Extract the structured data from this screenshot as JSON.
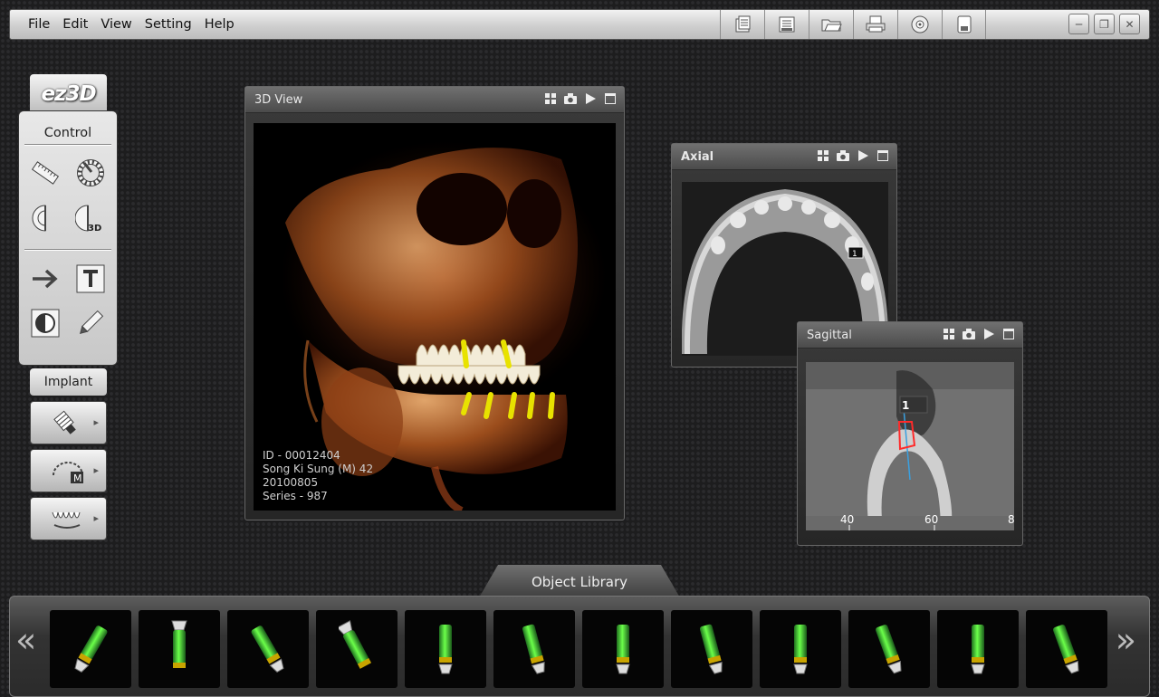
{
  "menu": {
    "items": [
      "File",
      "Edit",
      "View",
      "Setting",
      "Help"
    ]
  },
  "toolbar_icons": [
    "document-list-icon",
    "save-icon",
    "open-folder-icon",
    "print-icon",
    "disc-icon",
    "save-as-icon"
  ],
  "logo": {
    "text": "ez3D"
  },
  "control": {
    "title": "Control",
    "tools": [
      "ruler-icon",
      "angle-ring-icon",
      "half-circle-icon",
      "half-circle-3d-icon",
      "arrow-icon",
      "text-tool-icon",
      "contrast-icon",
      "pencil-icon"
    ]
  },
  "implant": {
    "label": "Implant",
    "buttons": [
      "implant-flashlight-icon",
      "arch-m-icon",
      "teeth-icon"
    ]
  },
  "views": {
    "view3d": {
      "title": "3D View",
      "patient": {
        "id": "ID - 00012404",
        "name": "Song Ki Sung (M) 42",
        "date": "20100805",
        "series": "Series - 987"
      }
    },
    "axial": {
      "title": "Axial",
      "marker": "1"
    },
    "sagittal": {
      "title": "Sagittal",
      "marker": "1",
      "ruler": [
        "40",
        "60",
        "8"
      ]
    }
  },
  "library": {
    "title": "Object Library",
    "left_arrow": "«",
    "right_arrow": "»",
    "items": 12
  },
  "colors": {
    "accent_implant": "#e8e200",
    "green_implant": "#3fbf3f",
    "outline": "#ff2a2a",
    "axis_line": "#3aa0e0"
  }
}
